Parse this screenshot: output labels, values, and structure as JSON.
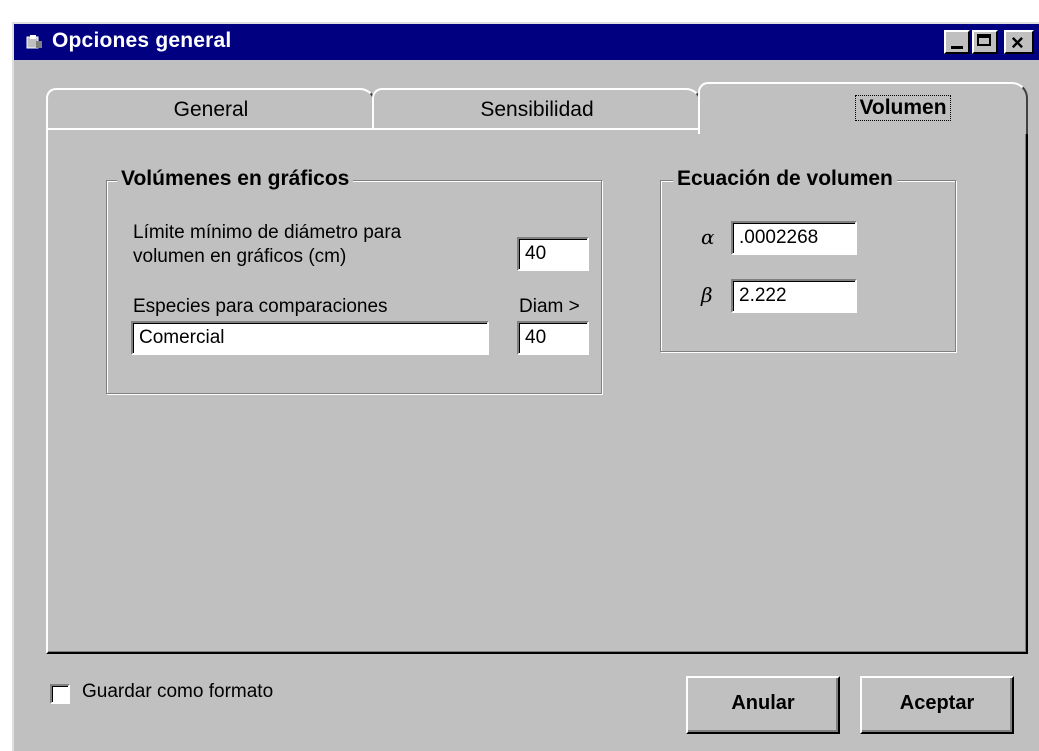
{
  "window": {
    "title": "Opciones general",
    "controls": {
      "minimize_icon": "minimize-icon",
      "maximize_icon": "maximize-icon",
      "close_icon": "close-icon"
    }
  },
  "tabs": [
    {
      "label": "General",
      "selected": false
    },
    {
      "label": "Sensibilidad",
      "selected": false
    },
    {
      "label": "Volumen",
      "selected": true
    }
  ],
  "volumenes_group": {
    "legend": "Volúmenes en gráficos",
    "min_diam_label_line1": "Límite mínimo de diámetro para",
    "min_diam_label_line2": "volumen en gráficos (cm)",
    "min_diam_value": "40",
    "especies_label": "Especies para comparaciones",
    "diam_label": "Diam >",
    "especies_value": "Comercial",
    "diam_value": "40"
  },
  "ecuacion_group": {
    "legend": "Ecuación de volumen",
    "alpha_symbol": "α",
    "alpha_value": ".0002268",
    "beta_symbol": "β",
    "beta_value": "2.222"
  },
  "footer": {
    "checkbox_label": "Guardar como formato",
    "checkbox_checked": false,
    "cancel_label": "Anular",
    "accept_label": "Aceptar"
  },
  "colors": {
    "titlebar": "#000080",
    "face": "#c0c0c0",
    "title_text": "#ffffff"
  }
}
